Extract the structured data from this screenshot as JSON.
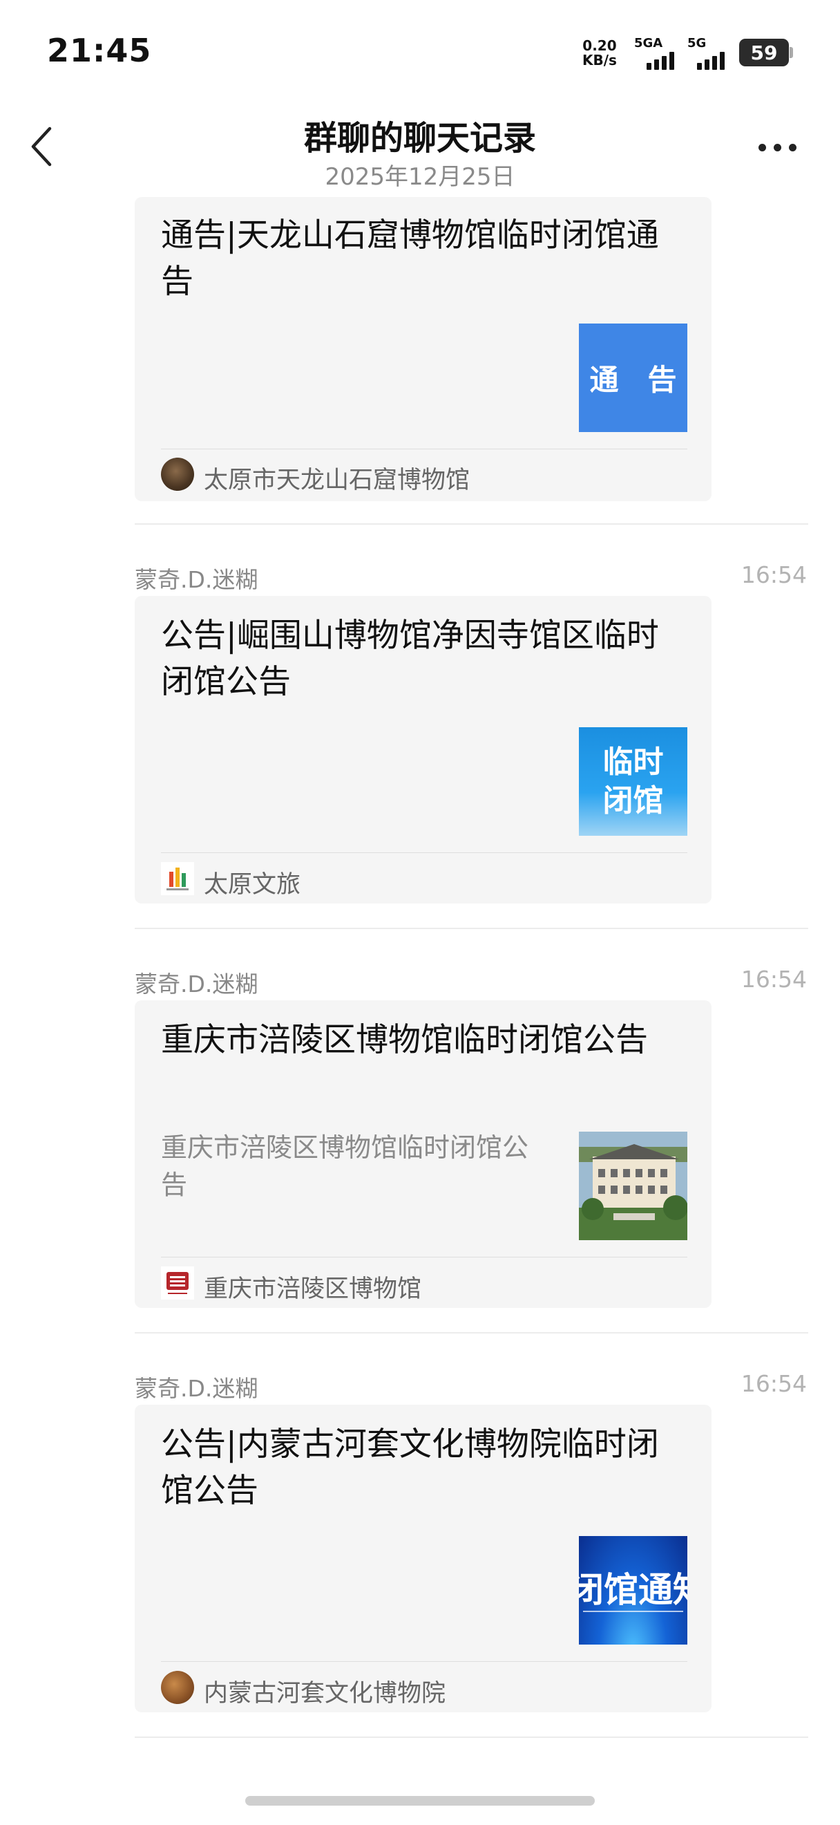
{
  "status_bar": {
    "time": "21:45",
    "speed_value": "0.20",
    "speed_unit": "KB/s",
    "net1": "5GA",
    "net2": "5G",
    "battery": "59"
  },
  "header": {
    "title": "群聊的聊天记录",
    "date": "2025年12月25日"
  },
  "messages": [
    {
      "title": "通告|天龙山石窟博物馆临时闭馆通告",
      "thumb_text": "通　告",
      "source": "太原市天龙山石窟博物馆"
    },
    {
      "sender": "蒙奇.D.迷糊",
      "time": "16:54",
      "title": "公告|崛围山博物馆净因寺馆区临时闭馆公告",
      "thumb_line1": "临时",
      "thumb_line2": "闭馆",
      "source": "太原文旅"
    },
    {
      "sender": "蒙奇.D.迷糊",
      "time": "16:54",
      "title": "重庆市涪陵区博物馆临时闭馆公告",
      "desc": "重庆市涪陵区博物馆临时闭馆公告",
      "source": "重庆市涪陵区博物馆"
    },
    {
      "sender": "蒙奇.D.迷糊",
      "time": "16:54",
      "title": "公告|内蒙古河套文化博物院临时闭馆公告",
      "thumb_text": "闭馆通知",
      "source": "内蒙古河套文化博物院"
    }
  ],
  "colors": {
    "card_bg": "#f5f5f5",
    "notice_blue": "#3f86e6",
    "muted_text": "#8a8a8a"
  }
}
